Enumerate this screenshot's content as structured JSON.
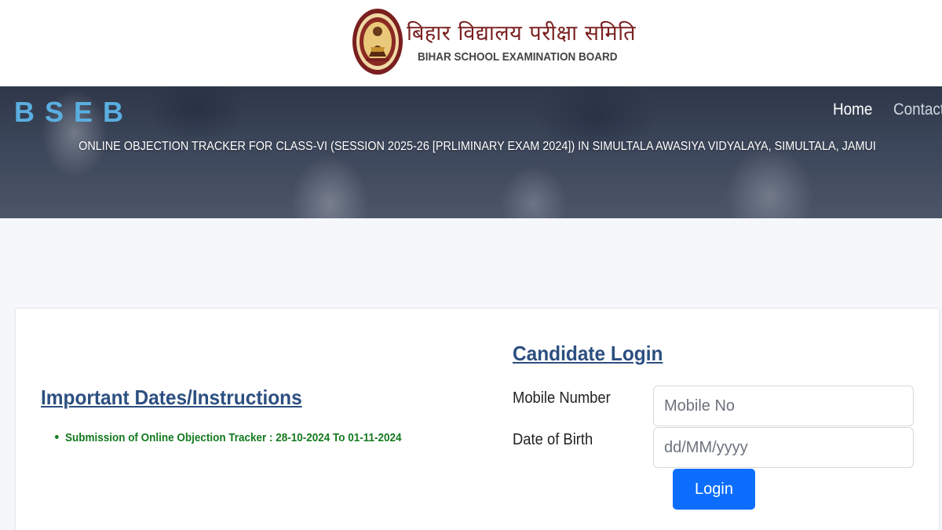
{
  "header": {
    "logo_hindi": "बिहार विद्यालय परीक्षा समिति",
    "logo_english": "BIHAR SCHOOL EXAMINATION BOARD",
    "seal_icon": "bseb-seal-icon"
  },
  "banner": {
    "brand": "BSEB",
    "title": "ONLINE OBJECTION TRACKER FOR CLASS-VI (SESSION 2025-26 [PRLIMINARY EXAM 2024]) IN SIMULTALA AWASIYA VIDYALAYA, SIMULTALA, JAMUI"
  },
  "nav": {
    "home": "Home",
    "contact": "Contact"
  },
  "instructions": {
    "heading": "Important Dates/Instructions",
    "items": [
      "Submission of Online Objection Tracker : 28-10-2024 To 01-11-2024"
    ]
  },
  "login": {
    "heading": "Candidate Login",
    "mobile_label": "Mobile Number",
    "mobile_placeholder": "Mobile No",
    "dob_label": "Date of Birth",
    "dob_placeholder": "dd/MM/yyyy",
    "button": "Login"
  },
  "colors": {
    "brand": "#5aaee0",
    "heading": "#2c4f80",
    "instruction_text": "#147a1e",
    "button": "#0d6efd",
    "logo_hindi": "#7a1f1f"
  }
}
